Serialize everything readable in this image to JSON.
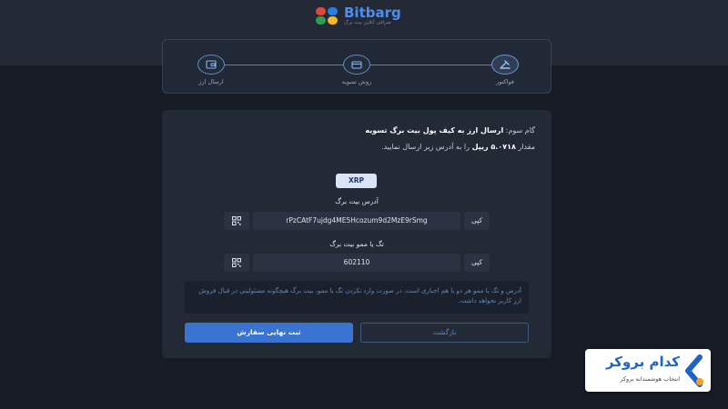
{
  "brand": {
    "name": "Bitbarg",
    "tagline": "صرافی آنلاین بیت برگ"
  },
  "stepper": {
    "steps": [
      {
        "label": "فواکتور",
        "icon": "hammer-icon",
        "active": true
      },
      {
        "label": "روش تسویه",
        "icon": "card-icon",
        "active": false
      },
      {
        "label": "ارسال ارز",
        "icon": "wallet-icon",
        "active": false
      }
    ]
  },
  "card": {
    "step_prefix": "گام سوم:",
    "step_title": "ارسال ارز به کیف پول بیت برگ تسویه",
    "amount_prefix": "مقدار",
    "amount_value": "۵.۰۷۱۸ ریپل",
    "amount_suffix": "را به آدرس زیر ارسال نمایید.",
    "currency_badge": "XRP",
    "address": {
      "label": "آدرس بیت برگ",
      "value": "rPzCAtF7ujdg4ME5Hcozum9d2MzE9rSmg",
      "copy_label": "کپی"
    },
    "memo": {
      "label": "تگ یا ممو بیت برگ",
      "value": "602110",
      "copy_label": "کپی"
    },
    "warning_text": "آدرس و تگ یا ممو هر دو با هم اجباری است. در صورت وارد نکردن تگ یا ممو، بیت برگ هیچگونه مسئولیتی در قبال فروش ارز کاربر نخواهد داشت.",
    "submit_label": "ثبت نهایی سفارش",
    "back_label": "بازگشت"
  },
  "broker_badge": {
    "name": "کدام بروکر",
    "tagline": "انتخاب هوشمندانه بروکر"
  },
  "colors": {
    "accent": "#3b73d1",
    "background": "#161b26",
    "card": "#222a36"
  }
}
